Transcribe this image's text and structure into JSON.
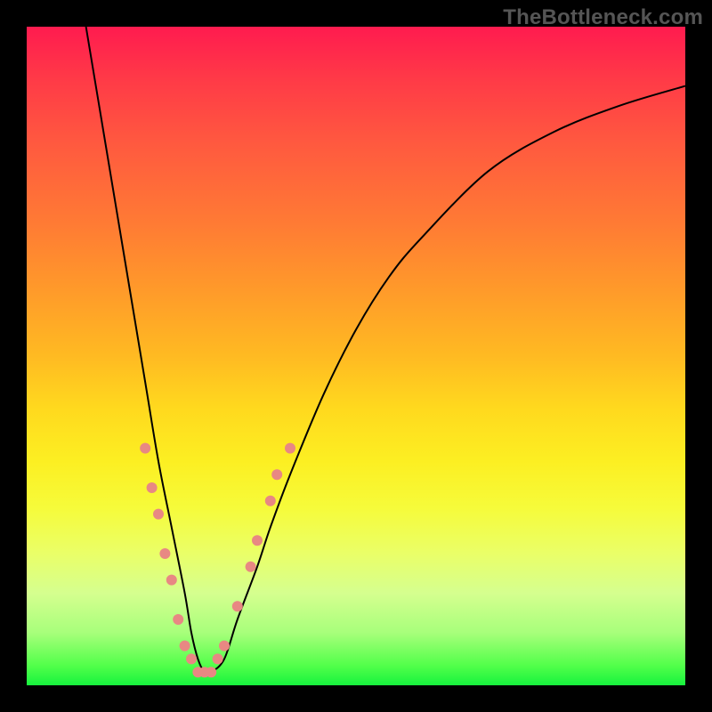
{
  "watermark": "TheBottleneck.com",
  "chart_data": {
    "type": "line",
    "title": "",
    "xlabel": "",
    "ylabel": "",
    "xlim": [
      0,
      100
    ],
    "ylim": [
      0,
      100
    ],
    "grid": false,
    "legend": false,
    "series": [
      {
        "name": "curve",
        "x": [
          9,
          12,
          15,
          18,
          20,
          22,
          24,
          25,
          26,
          27,
          28,
          30,
          32,
          35,
          37,
          40,
          45,
          50,
          55,
          60,
          70,
          80,
          90,
          100
        ],
        "y": [
          100,
          82,
          64,
          46,
          34,
          24,
          14,
          8,
          4,
          2,
          2,
          4,
          10,
          18,
          24,
          32,
          44,
          54,
          62,
          68,
          78,
          84,
          88,
          91
        ],
        "stroke": "#000000",
        "stroke_width": 2
      }
    ],
    "markers": [
      {
        "x": 18,
        "y": 36,
        "r": 6,
        "fill": "#e88883"
      },
      {
        "x": 19,
        "y": 30,
        "r": 6,
        "fill": "#e88883"
      },
      {
        "x": 20,
        "y": 26,
        "r": 6,
        "fill": "#e88883"
      },
      {
        "x": 21,
        "y": 20,
        "r": 6,
        "fill": "#e88883"
      },
      {
        "x": 22,
        "y": 16,
        "r": 6,
        "fill": "#e88883"
      },
      {
        "x": 23,
        "y": 10,
        "r": 6,
        "fill": "#e88883"
      },
      {
        "x": 24,
        "y": 6,
        "r": 6,
        "fill": "#e88883"
      },
      {
        "x": 25,
        "y": 4,
        "r": 6,
        "fill": "#e88883"
      },
      {
        "x": 26,
        "y": 2,
        "r": 6,
        "fill": "#e88883"
      },
      {
        "x": 27,
        "y": 2,
        "r": 6,
        "fill": "#e88883"
      },
      {
        "x": 28,
        "y": 2,
        "r": 6,
        "fill": "#e88883"
      },
      {
        "x": 29,
        "y": 4,
        "r": 6,
        "fill": "#e88883"
      },
      {
        "x": 30,
        "y": 6,
        "r": 6,
        "fill": "#e88883"
      },
      {
        "x": 32,
        "y": 12,
        "r": 6,
        "fill": "#e88883"
      },
      {
        "x": 34,
        "y": 18,
        "r": 6,
        "fill": "#e88883"
      },
      {
        "x": 35,
        "y": 22,
        "r": 6,
        "fill": "#e88883"
      },
      {
        "x": 37,
        "y": 28,
        "r": 6,
        "fill": "#e88883"
      },
      {
        "x": 38,
        "y": 32,
        "r": 6,
        "fill": "#e88883"
      },
      {
        "x": 40,
        "y": 36,
        "r": 6,
        "fill": "#e88883"
      }
    ]
  }
}
